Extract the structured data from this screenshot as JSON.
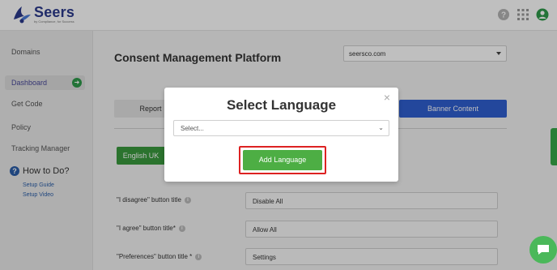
{
  "header": {
    "brand": "Seers",
    "brand_sub": "by Compliance, for Success",
    "icons": [
      "help-icon",
      "apps-grid-icon",
      "account-icon"
    ]
  },
  "sidebar": {
    "items": [
      {
        "label": "Domains"
      },
      {
        "label": "Dashboard",
        "active": true
      },
      {
        "label": "Get Code"
      },
      {
        "label": "Policy"
      },
      {
        "label": "Tracking Manager"
      }
    ],
    "howto": "How to Do?",
    "links": [
      "Setup Guide",
      "Setup Video"
    ]
  },
  "main": {
    "title": "Consent Management Platform",
    "domain": "seersco.com",
    "tabs": [
      {
        "label": "Report"
      },
      {
        "label": "Banner Content"
      }
    ],
    "language_button": "English UK",
    "rows": [
      {
        "label": "\"I disagree\" button title",
        "value": "Disable All"
      },
      {
        "label": "\"I agree\" button title*",
        "value": "Allow All"
      },
      {
        "label": "\"Preferences\" button title *",
        "value": "Settings"
      }
    ]
  },
  "modal": {
    "title": "Select Language",
    "select_placeholder": "Select...",
    "add_button": "Add Language",
    "close": "×"
  },
  "colors": {
    "brand": "#2b3a8c",
    "primary_blue": "#2f5fd0",
    "green": "#4dae44",
    "highlight_red": "#dd2222"
  }
}
